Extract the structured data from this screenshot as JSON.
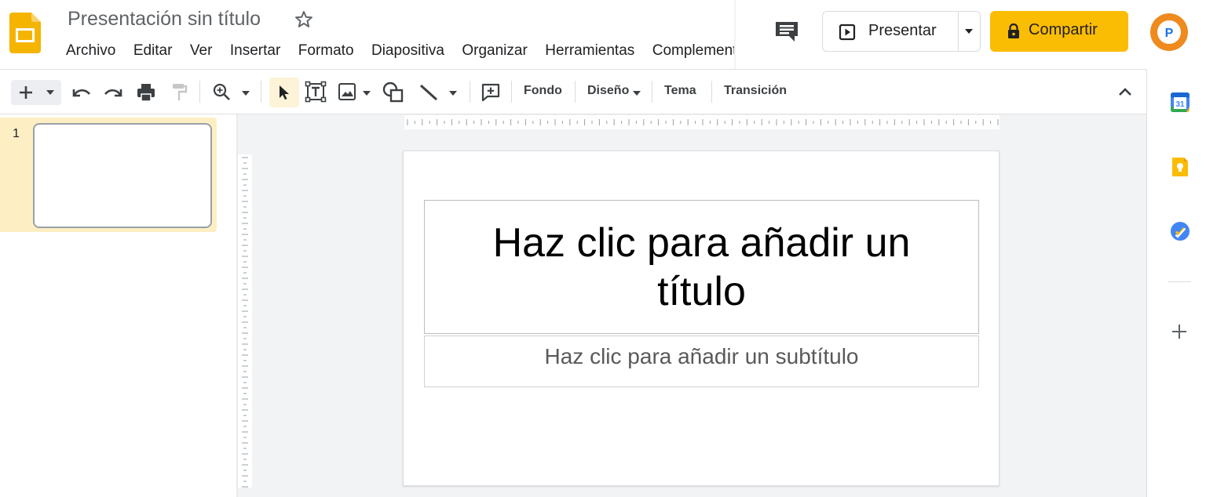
{
  "app": {
    "document_title": "Presentación sin título"
  },
  "menu": [
    "Archivo",
    "Editar",
    "Ver",
    "Insertar",
    "Formato",
    "Diapositiva",
    "Organizar",
    "Herramientas",
    "Complementos"
  ],
  "header": {
    "present_label": "Presentar",
    "share_label": "Compartir",
    "avatar_letter": "P"
  },
  "toolbar": {
    "background_label": "Fondo",
    "layout_label": "Diseño",
    "theme_label": "Tema",
    "transition_label": "Transición",
    "icons": [
      "plus-icon",
      "dropdown-icon",
      "undo-icon",
      "redo-icon",
      "print-icon",
      "paint-format-icon",
      "zoom-icon",
      "select-cursor-icon",
      "text-box-icon",
      "image-icon",
      "shape-icon",
      "line-icon",
      "comment-add-icon",
      "collapse-icon"
    ]
  },
  "filmstrip": {
    "slides": [
      {
        "number": "1"
      }
    ]
  },
  "slide": {
    "title_placeholder": "Haz clic para añadir un título",
    "subtitle_placeholder": "Haz clic para añadir un subtítulo"
  },
  "side_panel": {
    "calendar_day": "31",
    "icons": [
      "calendar-icon",
      "keep-icon",
      "tasks-icon",
      "add-addon-icon"
    ]
  },
  "colors": {
    "brand_yellow": "#fbbc04",
    "filmstrip_selected": "#fdefc3",
    "select_tool_active": "#fdf3d8",
    "avatar_orange": "#ef8a1e",
    "tasks_blue": "#4285f4"
  }
}
